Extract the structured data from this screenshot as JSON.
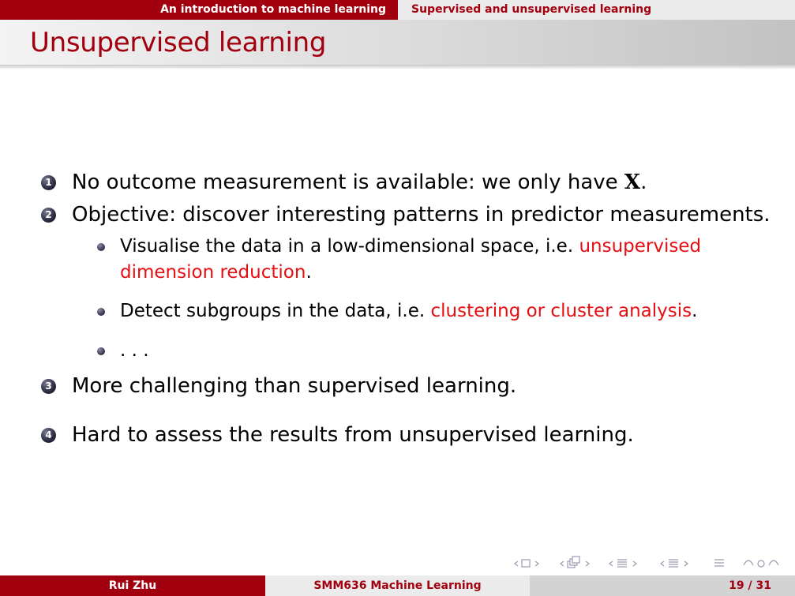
{
  "header": {
    "section": "An introduction to machine learning",
    "subsection": "Supervised and unsupervised learning"
  },
  "frame": {
    "title": "Unsupervised learning"
  },
  "items": [
    {
      "number": "1",
      "text_before": "No outcome measurement is available:  we only have ",
      "math": "X",
      "text_after": "."
    },
    {
      "number": "2",
      "text": "Objective:  discover interesting patterns in predictor measurements.",
      "subitems": [
        {
          "line1_plain": "Visualise the data in a low-dimensional space, i.e. ",
          "line1_red": "unsupervised",
          "line2_red": "dimension reduction",
          "line2_plain": "."
        },
        {
          "plain": "Detect subgroups in the data, i.e. ",
          "red": "clustering or cluster analysis",
          "after": "."
        },
        {
          "plain": ". . ."
        }
      ]
    },
    {
      "number": "3",
      "text": "More challenging than supervised learning."
    },
    {
      "number": "4",
      "text": "Hard to assess the results from unsupervised learning."
    }
  ],
  "footer": {
    "author": "Rui Zhu",
    "course": "SMM636 Machine Learning",
    "page": "19 / 31"
  },
  "nav_symbols": [
    "frame-nav-icon",
    "subsection-nav-icon",
    "section-nav-icon",
    "outline-nav-icon",
    "align-icon",
    "search-icon"
  ],
  "colors": {
    "accent": "#a3000f",
    "highlight": "#e50f12",
    "light_grey": "#ebebeb"
  }
}
